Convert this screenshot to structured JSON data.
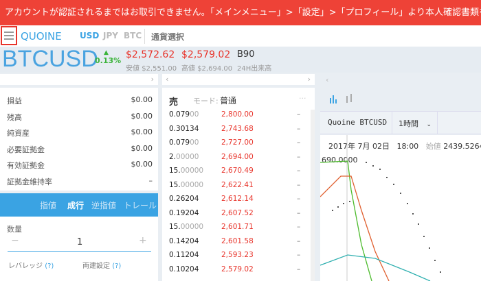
{
  "banner": "アカウントが認証されるまではお取引できません。「メインメニュー」>「設定」>「プロフィール」より本人確認書類をアップロード",
  "nav": {
    "logo": "QUOINE",
    "currencies": [
      "USD",
      "JPY",
      "BTC"
    ],
    "currency_select": "通貨選択"
  },
  "ticker": {
    "symbol": "BTCUSD",
    "change": "0.13%",
    "bid": "$2,572.62",
    "low_label": "安値",
    "low": "$2,551.00",
    "ask": "$2,579.02",
    "high_label": "高値",
    "high": "$2,694.00",
    "volume": "B90",
    "volume_label": "24H出来高"
  },
  "account": {
    "rows": [
      {
        "label": "損益",
        "value": "$0.00"
      },
      {
        "label": "残高",
        "value": "$0.00"
      },
      {
        "label": "純資産",
        "value": "$0.00"
      },
      {
        "label": "必要証拠金",
        "value": "$0.00"
      },
      {
        "label": "有効証拠金",
        "value": "$0.00"
      },
      {
        "label": "証拠金維持率",
        "value": "–"
      }
    ]
  },
  "order": {
    "tabs": [
      "指値",
      "成行",
      "逆指値",
      "トレール"
    ],
    "active_tab": "成行",
    "qty_label": "数量",
    "qty": "1",
    "minus": "−",
    "plus": "+",
    "leverage_label": "レバレッジ",
    "leverage_help": "(?)",
    "settle_label": "両建設定",
    "settle_help": "(?)"
  },
  "orderbook": {
    "side": "売",
    "mode_label": "モード:",
    "mode": "普通",
    "more": "···",
    "rows": [
      {
        "q": "0.079",
        "qd": "00",
        "p": "2,800.00",
        "d": "–"
      },
      {
        "q": "0.30134",
        "qd": "",
        "p": "2,743.68",
        "d": "–"
      },
      {
        "q": "0.079",
        "qd": "00",
        "p": "2,727.00",
        "d": "–"
      },
      {
        "q": "2.",
        "qd": "00000",
        "p": "2,694.00",
        "d": "–"
      },
      {
        "q": "15.",
        "qd": "00000",
        "p": "2,670.49",
        "d": "–"
      },
      {
        "q": "15.",
        "qd": "00000",
        "p": "2,622.41",
        "d": "–"
      },
      {
        "q": "0.26204",
        "qd": "",
        "p": "2,612.14",
        "d": "–"
      },
      {
        "q": "0.19204",
        "qd": "",
        "p": "2,607.52",
        "d": "–"
      },
      {
        "q": "15.",
        "qd": "00000",
        "p": "2,601.71",
        "d": "–"
      },
      {
        "q": "0.14204",
        "qd": "",
        "p": "2,601.58",
        "d": "–"
      },
      {
        "q": "0.11204",
        "qd": "",
        "p": "2,593.23",
        "d": "–"
      },
      {
        "q": "0.10204",
        "qd": "",
        "p": "2,579.02",
        "d": "–"
      }
    ]
  },
  "chart": {
    "pair": "Quoine BTCUSD",
    "interval": "1時間",
    "date": "2017年 7月 02日",
    "time": "18:00",
    "open_label": "始値",
    "open": "2439.5264",
    "price_label": "690.0000"
  },
  "colors": {
    "accent": "#3aa3e3",
    "red": "#e8332a",
    "green": "#3cb43c",
    "banner": "#ee4237"
  }
}
